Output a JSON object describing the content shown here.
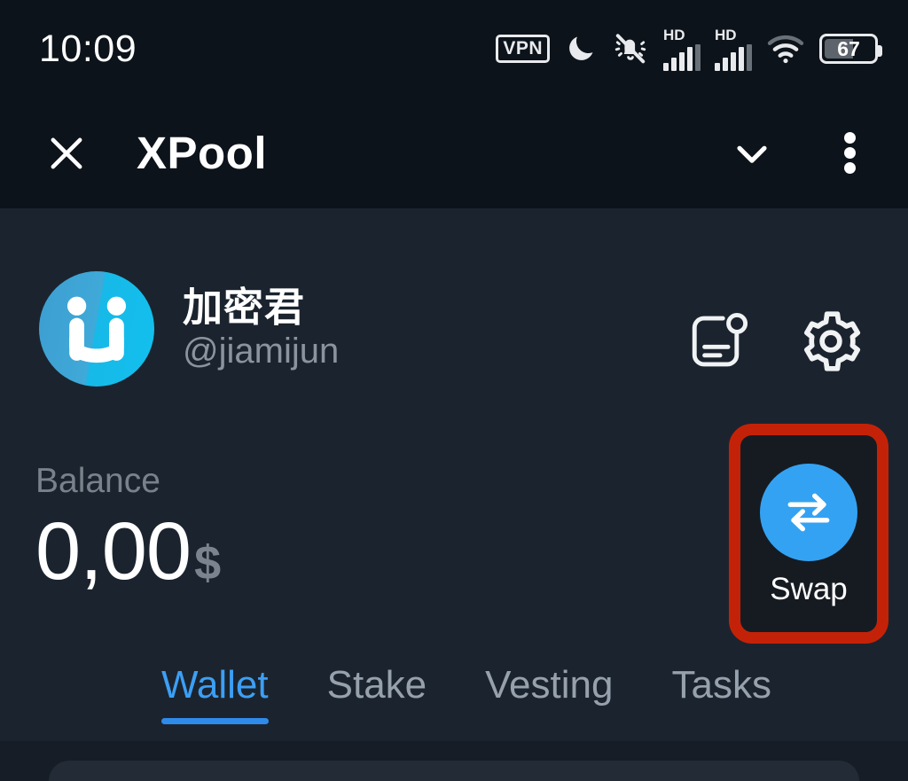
{
  "status_bar": {
    "time": "10:09",
    "icons": [
      {
        "name": "vpn-icon",
        "label": "VPN"
      },
      {
        "name": "do-not-disturb-moon-icon",
        "label": ""
      },
      {
        "name": "vibrate-muted-bell-icon",
        "label": ""
      },
      {
        "name": "signal-sim1-icon",
        "label": "HD"
      },
      {
        "name": "signal-sim2-icon",
        "label": "HD"
      },
      {
        "name": "wifi-icon",
        "label": ""
      }
    ],
    "battery": {
      "level": "67"
    }
  },
  "app_bar": {
    "close_label": "×",
    "title": "XPool",
    "chevron_label": "",
    "menu_label": ""
  },
  "profile": {
    "display_name": "加密君",
    "handle": "@jiamijun",
    "avatar_name": "user-avatar",
    "actions": [
      {
        "name": "news-notification-icon",
        "has_badge": true
      },
      {
        "name": "settings-gear-icon",
        "has_badge": false
      }
    ]
  },
  "balance": {
    "label": "Balance",
    "value": "0,00",
    "currency": "$"
  },
  "swap": {
    "label": "Swap",
    "icon_name": "swap-arrows-icon",
    "accent_color": "#34a2f2",
    "highlight_color": "#c42208"
  },
  "tabs": [
    {
      "label": "Wallet",
      "active": true
    },
    {
      "label": "Stake",
      "active": false
    },
    {
      "label": "Vesting",
      "active": false
    },
    {
      "label": "Tasks",
      "active": false
    }
  ],
  "colors": {
    "app_bar_bg": "#0d131a",
    "content_bg": "#1b242e",
    "accent_blue": "#3c9ff5",
    "muted_text": "#8b949e",
    "card_bg": "#232b36"
  }
}
